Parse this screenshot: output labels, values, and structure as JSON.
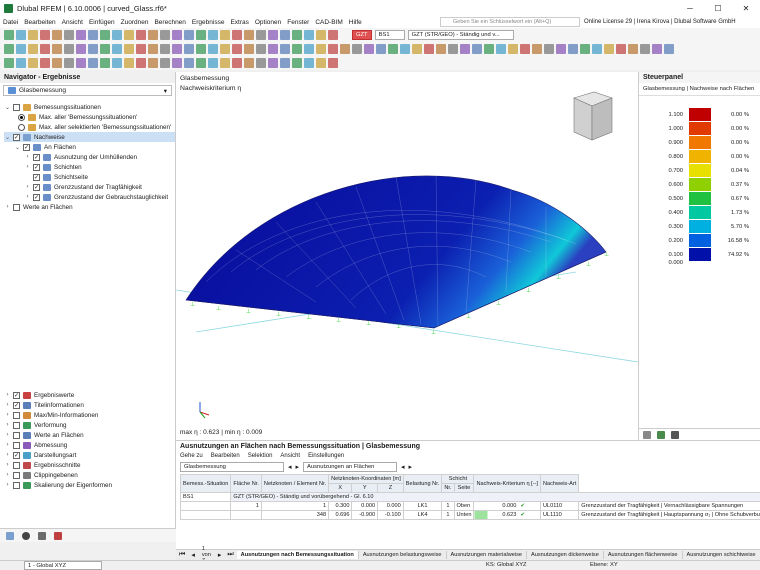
{
  "app": {
    "title": "Dlubal RFEM | 6.10.0006 | curved_Glass.rf6*"
  },
  "menu": [
    "Datei",
    "Bearbeiten",
    "Ansicht",
    "Einfügen",
    "Zuordnen",
    "Berechnen",
    "Ergebnisse",
    "Extras",
    "Optionen",
    "Fenster",
    "CAD-BIM",
    "Hilfe"
  ],
  "search": {
    "placeholder": "Geben Sie ein Schlüsselwort ein (Alt+Q)"
  },
  "license": "Online License 29 | Irena Kirova | Dlubal Software GmbH",
  "toolbar": {
    "gzt_badge": "GZT",
    "bs": "BS1",
    "combo": "GZT (STR/GEO) - Ständig und v..."
  },
  "navigator": {
    "title": "Navigator - Ergebnisse",
    "select": "Glasbemessung",
    "items_top": [
      "Bemessungssituationen",
      "Max. aller 'Bemessungssituationen'",
      "Max. aller selektierten 'Bemessungssituationen'",
      "Nachweise",
      "An Flächen",
      "Ausnutzung der Umhüllenden",
      "Schichten",
      "Schichtseite",
      "Grenzzustand der Tragfähigkeit",
      "Grenzzustand der Gebrauchstauglichkeit",
      "Werte an Flächen"
    ],
    "items_bottom": [
      "Ergebniswerte",
      "Titelinformationen",
      "Max/Min-Informationen",
      "Verformung",
      "Werte an Flächen",
      "Abmessung",
      "Darstellungsart",
      "Ergebnisschnitte",
      "Clippingebenen",
      "Skalierung der Eigenformen"
    ]
  },
  "view": {
    "title": "Glasbemessung",
    "subtitle": "Nachweiskriterium η",
    "maxmin": "max η : 0.623 | min η : 0.009"
  },
  "controlpanel": {
    "title": "Steuerpanel",
    "subtitle": "Glasbemessung | Nachweise nach Flächen",
    "legend": [
      {
        "v": "1.100",
        "c": "#c00000",
        "p": "0.00 %"
      },
      {
        "v": "1.000",
        "c": "#e03a00",
        "p": "0.00 %"
      },
      {
        "v": "0.900",
        "c": "#f07800",
        "p": "0.00 %"
      },
      {
        "v": "0.800",
        "c": "#f0b400",
        "p": "0.00 %"
      },
      {
        "v": "0.700",
        "c": "#e8e000",
        "p": "0.04 %"
      },
      {
        "v": "0.600",
        "c": "#90d000",
        "p": "0.37 %"
      },
      {
        "v": "0.500",
        "c": "#20c040",
        "p": "0.67 %"
      },
      {
        "v": "0.400",
        "c": "#00c8a0",
        "p": "1.73 %"
      },
      {
        "v": "0.300",
        "c": "#00b0e0",
        "p": "5.70 %"
      },
      {
        "v": "0.200",
        "c": "#0060e0",
        "p": "16.58 %"
      },
      {
        "v": "0.100",
        "c": "#0010a8",
        "p": "74.92 %"
      }
    ],
    "legend_min": "0.000"
  },
  "results": {
    "title": "Ausnutzungen an Flächen nach Bemessungssituation | Glasbemessung",
    "menu": [
      "Gehe zu",
      "Bearbeiten",
      "Selektion",
      "Ansicht",
      "Einstellungen"
    ],
    "combo1": "Glasbemessung",
    "combo2": "Ausnutzungen an Flächen",
    "headers": [
      "Bemess.-Situation",
      "Fläche Nr.",
      "Netzknoten / Element Nr.",
      "X",
      "Y",
      "Z",
      "Belastung Nr.",
      "Nr.",
      "Seite",
      "Nachweis-Kriterium η [--]",
      "Nachweis-Art",
      ""
    ],
    "group_header_coords": "Netzknoten-Koordinaten [m]",
    "group_header_layer": "Schicht",
    "bs_row": {
      "bs": "BS1",
      "desc": "GZT (STR/GEO) - Ständig und vorübergehend - Gl. 6.10"
    },
    "rows": [
      {
        "flaeche": "1",
        "knoten": "1",
        "x": "0.300",
        "y": "0.000",
        "z": "0.000",
        "last": "LK1",
        "nr": "1",
        "seite": "Oben",
        "eta": "0.000",
        "code": "UL0110",
        "desc": "Grenzzustand der Tragfähigkeit | Vernachlässigbare Spannungen"
      },
      {
        "flaeche": "",
        "knoten": "348",
        "x": "0.696",
        "y": "-0.900",
        "z": "-0.100",
        "last": "LK4",
        "nr": "1",
        "seite": "Unten",
        "eta": "0.623",
        "code": "UL1110",
        "desc": "Grenzzustand der Tragfähigkeit | Hauptspannung σ₁ | Ohne Schubverbund zwi"
      }
    ],
    "pager": "1 von 7",
    "tabs": [
      "Ausnutzungen nach Bemessungssituation",
      "Ausnutzungen belastungsweise",
      "Ausnutzungen materialweise",
      "Ausnutzungen dickenweise",
      "Ausnutzungen flächenweise",
      "Ausnutzungen schichtweise"
    ]
  },
  "statusbar": {
    "cs": "1 - Global XYZ",
    "ks": "KS: Global XYZ",
    "ebene": "Ebene: XY"
  }
}
